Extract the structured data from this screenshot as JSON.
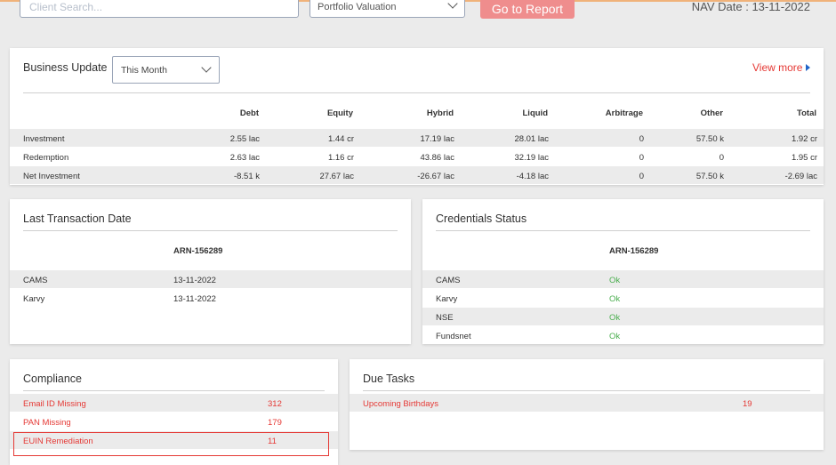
{
  "toolbar": {
    "search_placeholder": "Client Search...",
    "report_select": "Portfolio Valuation",
    "go_button": "Go to Report",
    "nav_date": "NAV Date : 13-11-2022"
  },
  "business_update": {
    "title": "Business Update",
    "period": "This Month",
    "view_more": "View more",
    "columns": [
      "Debt",
      "Equity",
      "Hybrid",
      "Liquid",
      "Arbitrage",
      "Other",
      "Total"
    ],
    "rows": [
      {
        "label": "Investment",
        "values": [
          "2.55 lac",
          "1.44 cr",
          "17.19 lac",
          "28.01 lac",
          "0",
          "57.50 k",
          "1.92 cr"
        ]
      },
      {
        "label": "Redemption",
        "values": [
          "2.63 lac",
          "1.16 cr",
          "43.86 lac",
          "32.19 lac",
          "0",
          "0",
          "1.95 cr"
        ]
      },
      {
        "label": "Net Investment",
        "values": [
          "-8.51 k",
          "27.67 lac",
          "-26.67 lac",
          "-4.18 lac",
          "0",
          "57.50 k",
          "-2.69 lac"
        ]
      }
    ]
  },
  "last_transaction": {
    "title": "Last Transaction Date",
    "arn": "ARN-156289",
    "rows": [
      {
        "label": "CAMS",
        "value": "13-11-2022"
      },
      {
        "label": "Karvy",
        "value": "13-11-2022"
      }
    ]
  },
  "credentials": {
    "title": "Credentials Status",
    "arn": "ARN-156289",
    "rows": [
      {
        "label": "CAMS",
        "value": "Ok"
      },
      {
        "label": "Karvy",
        "value": "Ok"
      },
      {
        "label": "NSE",
        "value": "Ok"
      },
      {
        "label": "Fundsnet",
        "value": "Ok"
      }
    ]
  },
  "compliance": {
    "title": "Compliance",
    "rows": [
      {
        "label": "Email ID Missing",
        "value": "312"
      },
      {
        "label": "PAN Missing",
        "value": "179"
      },
      {
        "label": "EUIN Remediation",
        "value": "11"
      }
    ]
  },
  "due_tasks": {
    "title": "Due Tasks",
    "rows": [
      {
        "label": "Upcoming Birthdays",
        "value": "19"
      }
    ]
  },
  "colors": {
    "accent_red": "#e53935",
    "ok_green": "#4caf50",
    "button_bg": "#ef8d8d"
  }
}
